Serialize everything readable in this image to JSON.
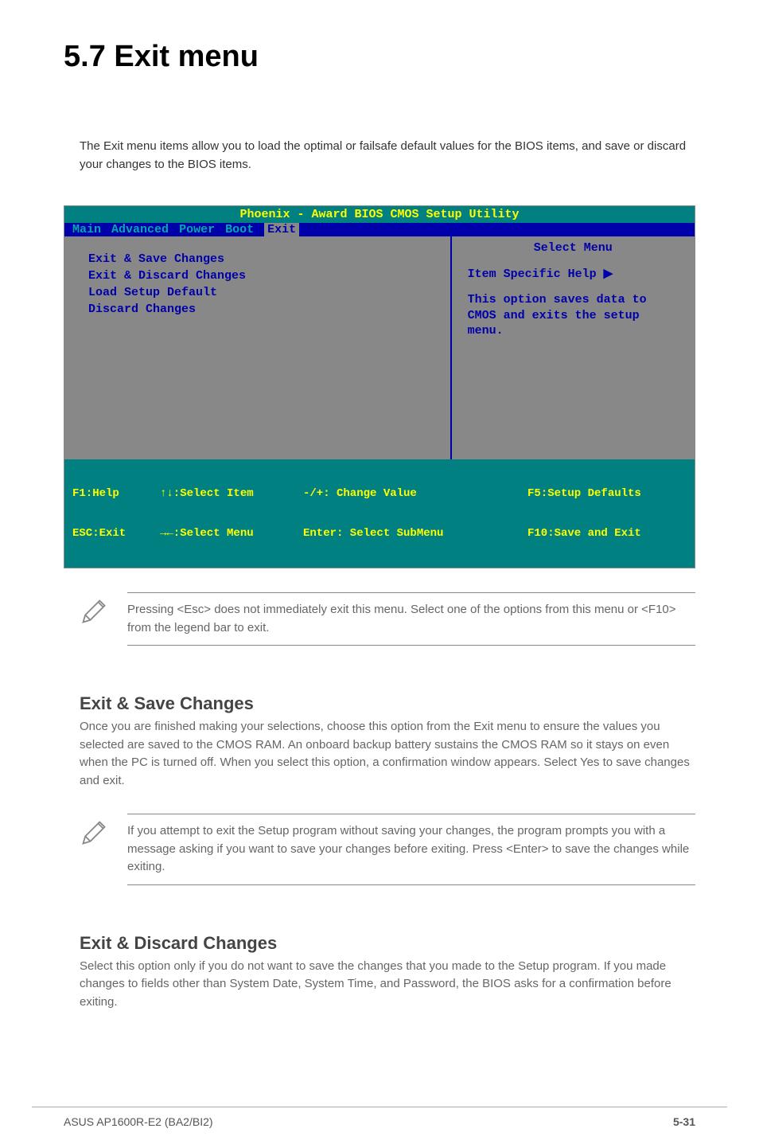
{
  "page": {
    "title": "5.7    Exit menu",
    "intro": "The Exit menu items allow you to load the optimal or failsafe default values for the BIOS items, and save or discard your changes to the BIOS items."
  },
  "bios": {
    "title": "Phoenix - Award BIOS CMOS Setup Utility",
    "menus": [
      "Main",
      "Advanced",
      "Power",
      "Boot",
      "Exit"
    ],
    "active_menu": "Exit",
    "items": [
      "Exit & Save Changes",
      "Exit & Discard Changes",
      "Load Setup Default",
      "Discard Changes"
    ],
    "help": {
      "header": "Select Menu",
      "item_specific": "Item Specific Help",
      "description": "This option saves data to CMOS and exits the setup menu."
    },
    "footer": {
      "f1": "F1:Help",
      "esc": "ESC:Exit",
      "select_item": "↑↓:Select Item",
      "select_menu": "→←:Select Menu",
      "change_value": "-/+: Change Value",
      "select_submenu": "Enter: Select SubMenu",
      "f5": "F5:Setup Defaults",
      "f10": "F10:Save and Exit"
    }
  },
  "note1": "Pressing <Esc> does not immediately exit this menu. Select one of the options from this menu or <F10> from the legend bar to exit.",
  "section1": {
    "heading": "Exit & Save Changes",
    "body": "Once you are finished making your selections, choose this option from the Exit menu to ensure the values you selected are saved to the CMOS RAM. An onboard backup battery sustains the CMOS RAM so it stays on even when the PC is turned off. When you select this option, a confirmation window appears. Select Yes to save changes and exit."
  },
  "note2": "If you attempt to exit the Setup program without saving your changes, the program prompts you with a message asking if you want to save your changes before exiting. Press <Enter> to save the changes while exiting.",
  "section2": {
    "heading": "Exit & Discard Changes",
    "body": "Select this option only if you do not want to save the changes that you made to the Setup program. If you made changes to fields other than System Date, System Time, and Password, the BIOS asks for a confirmation before exiting."
  },
  "footer": {
    "left": "ASUS AP1600R-E2 (BA2/BI2)",
    "right": "5-31"
  }
}
